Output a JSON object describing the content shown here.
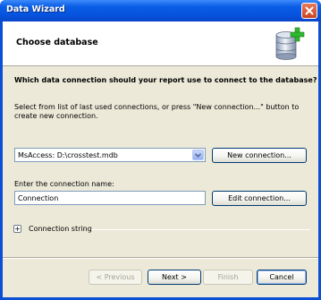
{
  "window": {
    "title": "Data Wizard"
  },
  "header": {
    "heading": "Choose database"
  },
  "main": {
    "question": "Which data connection should your report use to connect to the database?",
    "instructions": "Select from list of last used connections, or press \"New connection...\" button to create new connection.",
    "connection_select": {
      "value": "MsAccess: D:\\crosstest.mdb"
    },
    "new_connection_label": "New connection...",
    "name_label": "Enter the connection name:",
    "name_input": {
      "value": "Connection"
    },
    "edit_connection_label": "Edit connection...",
    "connection_string_label": "Connection string",
    "expander_glyph": "+"
  },
  "footer": {
    "previous_label": "< Previous",
    "next_label": "Next >",
    "finish_label": "Finish",
    "cancel_label": "Cancel"
  },
  "colors": {
    "titlebar": "#0b5ee6",
    "dialog_bg": "#ece9d8",
    "button_border": "#003c74",
    "close_button": "#c9431f"
  },
  "icons": {
    "close": "close-icon",
    "database": "database-add-icon",
    "dropdown": "chevron-down-icon",
    "expander": "plus-icon"
  }
}
